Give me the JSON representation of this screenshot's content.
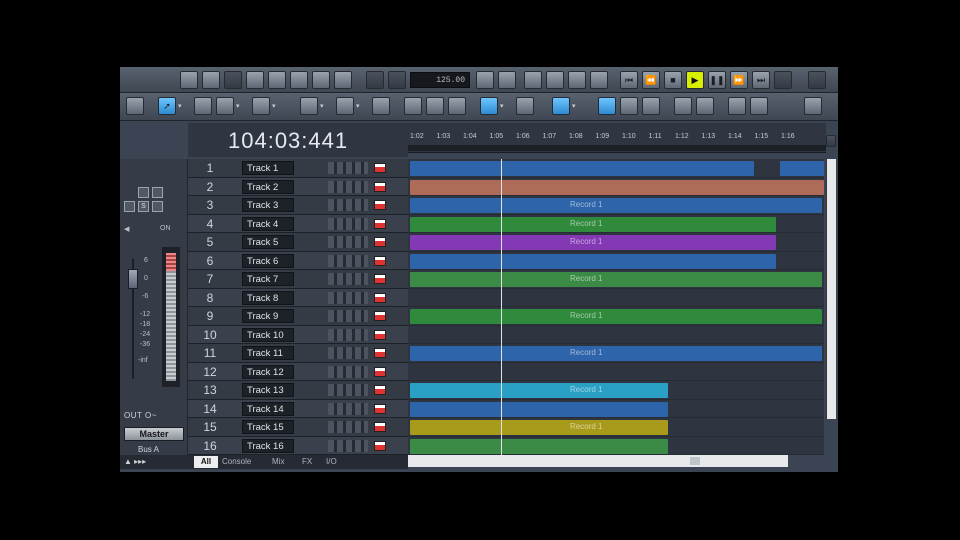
{
  "toolbar": {
    "tempo_value": "125.00"
  },
  "transport": {
    "time": "104:03:441"
  },
  "ruler": {
    "ticks": [
      "1:02",
      "1:03",
      "1:04",
      "1:05",
      "1:06",
      "1:07",
      "1:08",
      "1:09",
      "1:10",
      "1:11",
      "1:12",
      "1:13",
      "1:14",
      "1:15",
      "1:16"
    ]
  },
  "strip": {
    "scale": [
      "6",
      "0",
      "-6",
      "-12",
      "-18",
      "-24",
      "-36",
      "-inf"
    ],
    "out_label": "OUT O~",
    "master_label": "Master",
    "bus_label": "Bus A"
  },
  "tracks": [
    {
      "num": "1",
      "name": "Track 1"
    },
    {
      "num": "2",
      "name": "Track 2"
    },
    {
      "num": "3",
      "name": "Track 3"
    },
    {
      "num": "4",
      "name": "Track 4"
    },
    {
      "num": "5",
      "name": "Track 5"
    },
    {
      "num": "6",
      "name": "Track 6"
    },
    {
      "num": "7",
      "name": "Track 7"
    },
    {
      "num": "8",
      "name": "Track 8"
    },
    {
      "num": "9",
      "name": "Track 9"
    },
    {
      "num": "10",
      "name": "Track 10"
    },
    {
      "num": "11",
      "name": "Track 11"
    },
    {
      "num": "12",
      "name": "Track 12"
    },
    {
      "num": "13",
      "name": "Track 13"
    },
    {
      "num": "14",
      "name": "Track 14"
    },
    {
      "num": "15",
      "name": "Track 15"
    },
    {
      "num": "16",
      "name": "Track 16"
    }
  ],
  "clips": {
    "record_label": "Record 1"
  },
  "tabs": {
    "all": "All",
    "console": "Console",
    "mix": "Mix",
    "fx": "FX",
    "io": "I/O"
  },
  "colors": {
    "blue": "#2d64aa",
    "salmon": "#ad6b58",
    "green": "#2f8a3c",
    "purple": "#8338b4",
    "cyan": "#2aa0c4",
    "yellow": "#a89b1c",
    "play_button": "#d8f000"
  }
}
